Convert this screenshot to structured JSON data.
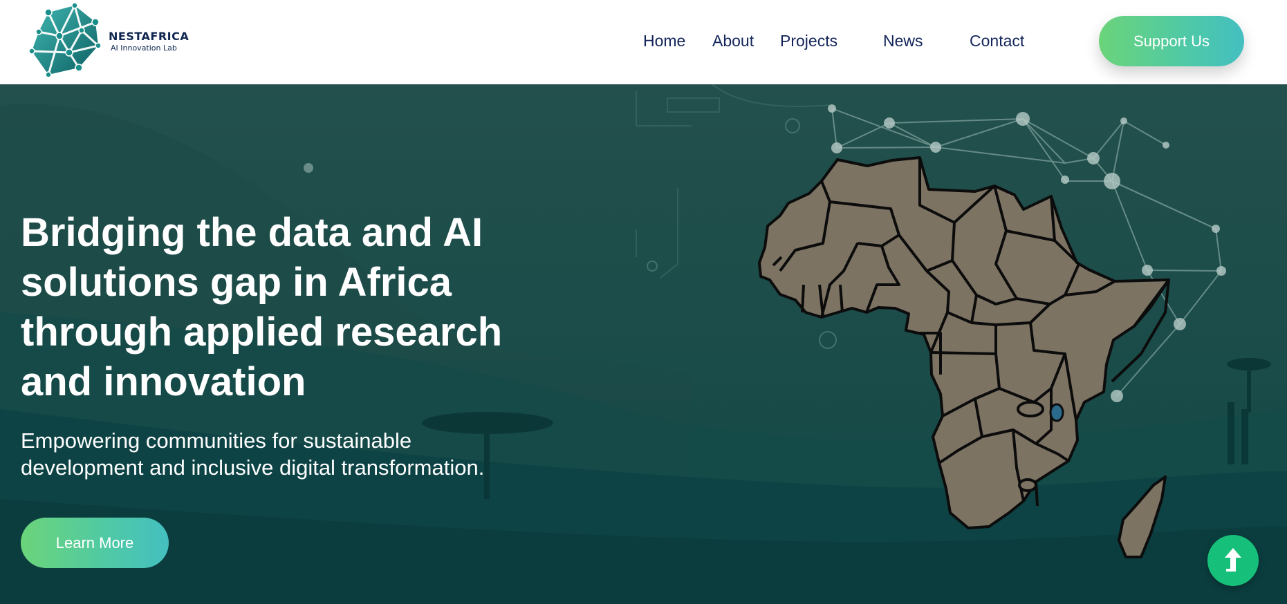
{
  "header": {
    "logo": {
      "name": "NESTAFRICA",
      "tagline": "AI Innovation Lab",
      "icon": "network-polyhedron-icon"
    },
    "nav": [
      {
        "label": "Home"
      },
      {
        "label": "About"
      },
      {
        "label": "Projects"
      },
      {
        "label": "News"
      },
      {
        "label": "Contact"
      }
    ],
    "cta_label": "Support Us"
  },
  "hero": {
    "title_lines": [
      "Bridging the data and AI",
      "solutions gap in Africa",
      "through applied research",
      "and innovation"
    ],
    "subtitle_lines": [
      "Empowering communities for sustainable",
      "development and inclusive digital transformation."
    ],
    "button_label": "Learn More",
    "background": "africa-map-network-illustration",
    "scroll_icon": "arrow-up-icon"
  },
  "colors": {
    "nav_text": "#13255a",
    "hero_bg": "#0e4a47",
    "button_gradient_start": "#6bd47a",
    "button_gradient_end": "#44bfc0",
    "scroll_button": "#16c07a",
    "map_fill": "#7d7363"
  }
}
